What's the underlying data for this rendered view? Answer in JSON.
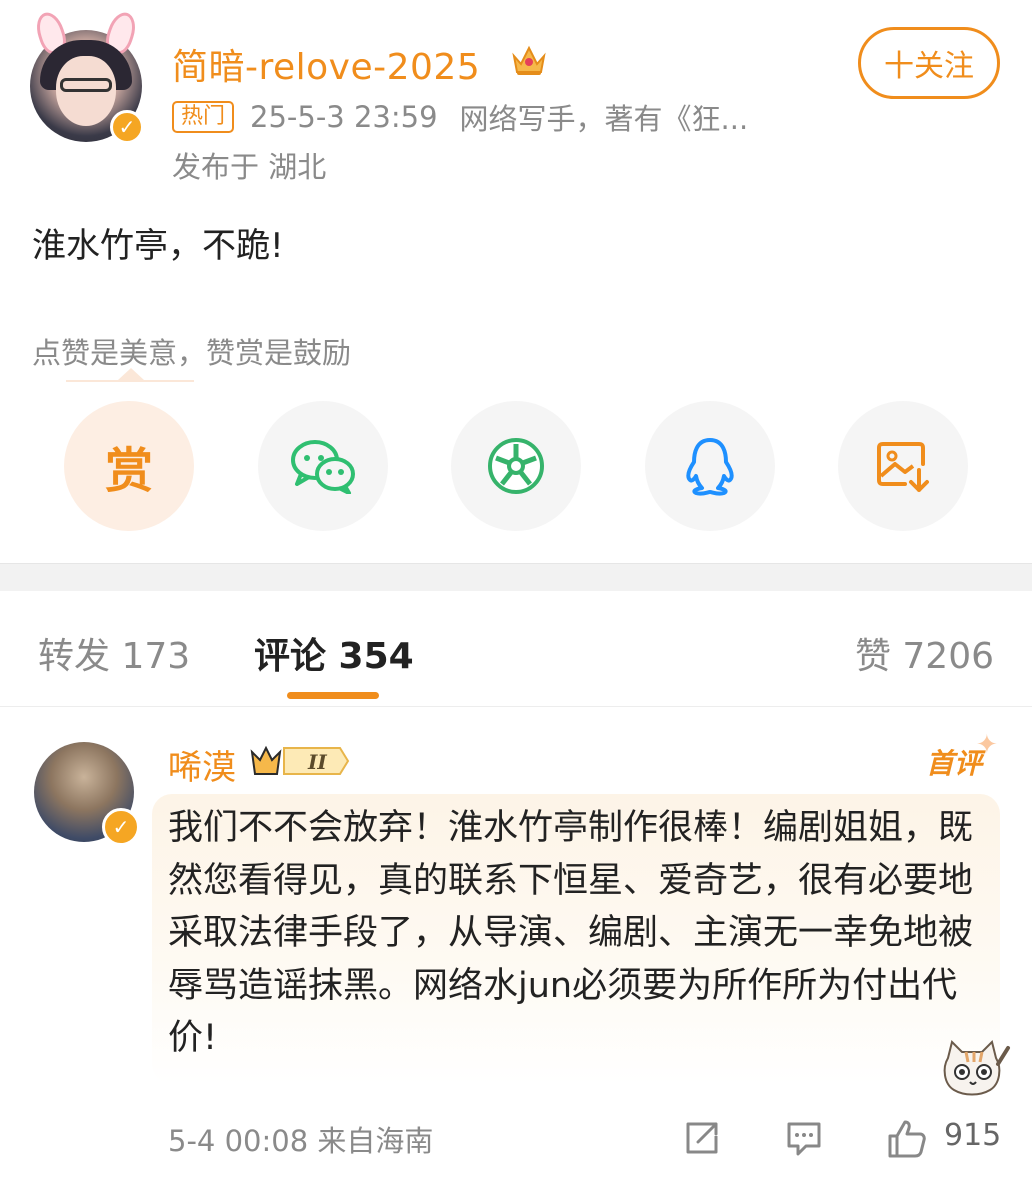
{
  "post": {
    "username": "简暗-relove-2025",
    "hot_badge": "热门",
    "time": "25-5-3 23:59",
    "bio": "网络写手，著有《狂...",
    "location": "发布于 湖北",
    "follow_label": "十关注",
    "content": "淮水竹亭，不跪!",
    "reward_tip": "点赞是美意，赞赏是鼓励"
  },
  "share": {
    "reward_label": "赏",
    "icons": [
      "wechat-icon",
      "moments-icon",
      "qq-icon",
      "save-image-icon"
    ]
  },
  "tabs": {
    "repost": "转发 173",
    "comments": "评论 354",
    "likes": "赞 7206"
  },
  "comment": {
    "username": "唏漠",
    "level": "II",
    "first_badge": "首评",
    "text": "我们不不会放弃！淮水竹亭制作很棒！编剧姐姐，既然您看得见，真的联系下恒星、爱奇艺，很有必要地采取法律手段了，从导演、编剧、主演无一幸免地被辱骂造谣抹黑。网络水jun必须要为所作所为付出代价!",
    "time": "5-4 00:08 来自海南",
    "like_count": "915"
  },
  "colors": {
    "accent": "#f08d1c",
    "muted": "#8a8a8a",
    "wechat": "#2fbf71",
    "qq": "#1e90ff"
  }
}
